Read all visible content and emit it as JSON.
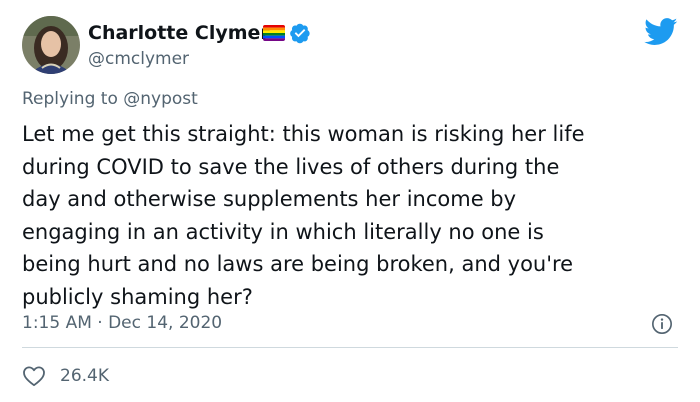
{
  "user": {
    "display_name": "Charlotte Clymer",
    "handle": "@cmclymer",
    "flag_icon": "rainbow-flag-icon",
    "verified_icon": "verified-badge-icon",
    "verified_color": "#1d9bf0"
  },
  "brand": {
    "logo_icon": "twitter-bird-icon",
    "color": "#1d9bf0"
  },
  "reply": {
    "prefix": "Replying to",
    "mention": "@nypost"
  },
  "tweet": {
    "lines": [
      "Let me get this straight: this woman is risking her life",
      "during COVID to save the lives of others during the",
      "day and otherwise supplements her income by",
      "engaging in an activity in which literally no one is",
      "being hurt and no laws are being broken, and you're",
      "publicly shaming her?"
    ],
    "timestamp": "1:15 AM · Dec 14, 2020",
    "info_icon": "info-icon"
  },
  "actions": {
    "like_icon": "heart-icon",
    "like_count": "26.4K"
  }
}
